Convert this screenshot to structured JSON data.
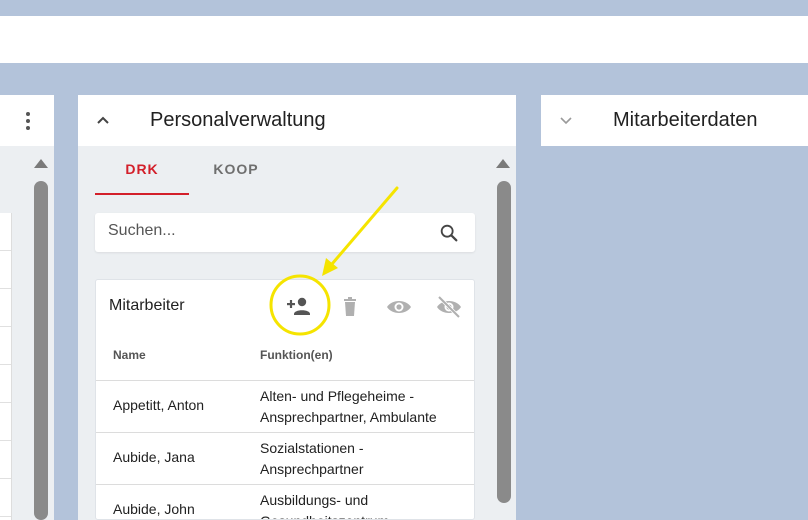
{
  "middle_panel": {
    "title": "Personalverwaltung",
    "tabs": [
      {
        "label": "DRK",
        "active": true
      },
      {
        "label": "KOOP",
        "active": false
      }
    ],
    "search": {
      "placeholder": "Suchen...",
      "value": ""
    },
    "card": {
      "title": "Mitarbeiter",
      "actions": [
        "add-person-icon",
        "delete-icon",
        "visibility-icon",
        "visibility-off-icon"
      ],
      "columns": [
        "Name",
        "Funktion(en)"
      ],
      "rows": [
        {
          "name": "Appetitt, Anton",
          "function": "Alten- und Pflegeheime - Ansprechpartner, Ambulante"
        },
        {
          "name": "Aubide, Jana",
          "function": "Sozialstationen - Ansprechpartner"
        },
        {
          "name": "Aubide, John",
          "function": "Ausbildungs- und Gesundheitszentrum"
        }
      ]
    }
  },
  "right_panel": {
    "title": "Mitarbeiterdaten"
  },
  "colors": {
    "accent": "#d31f2a",
    "highlight": "#f5e400",
    "background": "#b3c3da"
  }
}
